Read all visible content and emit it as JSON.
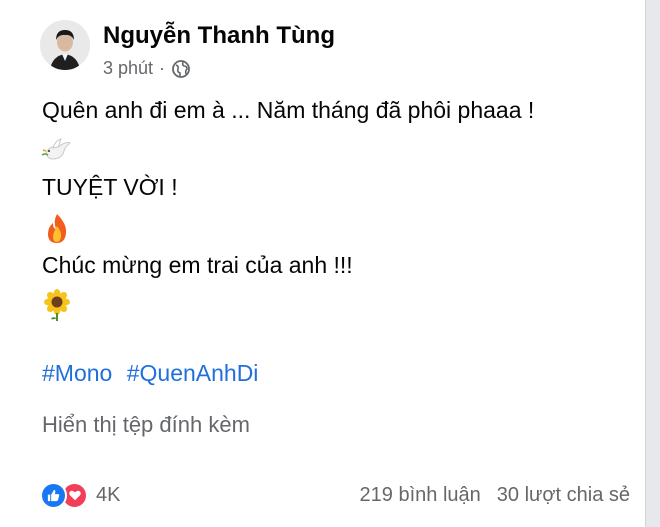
{
  "post": {
    "author": "Nguyễn Thanh Tùng",
    "time": "3 phút",
    "separator": "·",
    "privacy_icon": "globe-icon",
    "lines": {
      "line1": "Quên anh đi em à ... Năm tháng đã phôi phaaa !",
      "line2": "TUYỆT VỜI !",
      "line3": "Chúc mừng em trai của anh !!!"
    },
    "emojis": [
      "dove-icon",
      "fire-icon",
      "sunflower-icon"
    ],
    "hashtags": [
      "#Mono",
      "#QuenAnhDi"
    ],
    "attachment_link": "Hiển thị tệp đính kèm"
  },
  "footer": {
    "reactions": [
      "like-icon",
      "love-icon"
    ],
    "reaction_count": "4K",
    "comments": "219 bình luận",
    "shares": "30 lượt chia sẻ"
  },
  "colors": {
    "text": "#050505",
    "secondary": "#65676b",
    "hashtag": "#216fdb",
    "like": "#1877f2",
    "love": "#f33e58"
  }
}
